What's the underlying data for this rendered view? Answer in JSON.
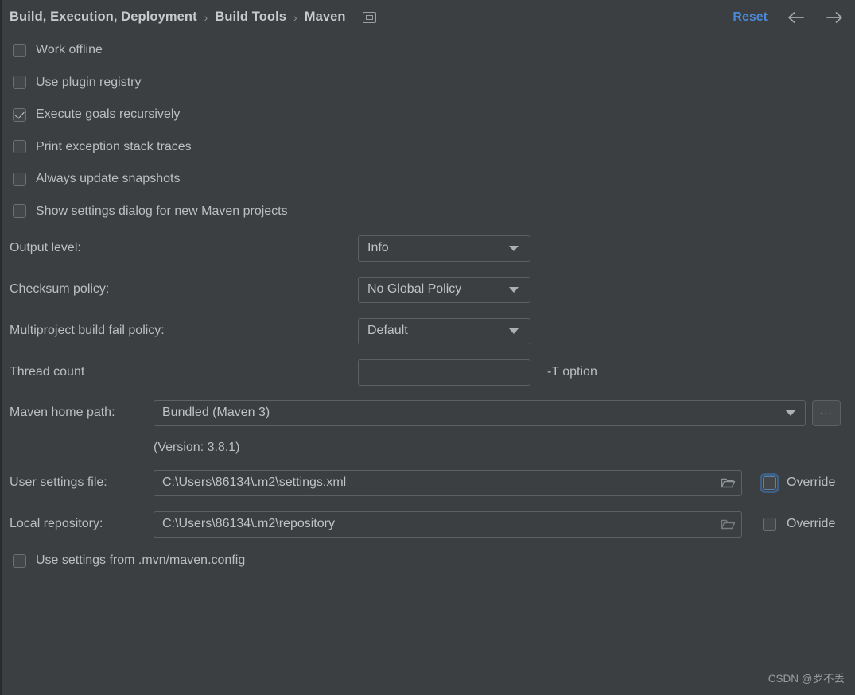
{
  "header": {
    "breadcrumb": [
      "Build, Execution, Deployment",
      "Build Tools",
      "Maven"
    ],
    "separator": "›",
    "window_icon": "window-icon",
    "reset_label": "Reset",
    "back_icon": "arrow-left-icon",
    "forward_icon": "arrow-right-icon"
  },
  "checkboxes": [
    {
      "label": "Work offline",
      "checked": false,
      "focused": false
    },
    {
      "label": "Use plugin registry",
      "checked": false,
      "focused": false
    },
    {
      "label": "Execute goals recursively",
      "checked": true,
      "focused": false
    },
    {
      "label": "Print exception stack traces",
      "checked": false,
      "focused": false
    },
    {
      "label": "Always update snapshots",
      "checked": false,
      "focused": false
    },
    {
      "label": "Show settings dialog for new Maven projects",
      "checked": false,
      "focused": false
    }
  ],
  "selects": [
    {
      "label": "Output level:",
      "value": "Info"
    },
    {
      "label": "Checksum policy:",
      "value": "No Global Policy"
    },
    {
      "label": "Multiproject build fail policy:",
      "value": "Default"
    }
  ],
  "thread_count": {
    "label": "Thread count",
    "value": "",
    "placeholder": "",
    "note": "-T option"
  },
  "maven_home": {
    "label": "Maven home path:",
    "value": "Bundled (Maven 3)",
    "browse_label": "...",
    "version_note": "(Version: 3.8.1)",
    "dropdown_icon": "chevron-down-icon"
  },
  "paths": [
    {
      "label": "User settings file:",
      "value": "C:\\Users\\86134\\.m2\\settings.xml",
      "folder_icon": "folder-icon",
      "override_label": "Override",
      "override_checked": false,
      "override_focused": true
    },
    {
      "label": "Local repository:",
      "value": "C:\\Users\\86134\\.m2\\repository",
      "folder_icon": "folder-icon",
      "override_label": "Override",
      "override_checked": false,
      "override_focused": false
    }
  ],
  "mvn_config": {
    "label": "Use settings from .mvn/maven.config",
    "checked": false
  },
  "watermark": "CSDN @罗不丢",
  "colors": {
    "background": "#3c3f41",
    "text": "#bcbfc1",
    "accent_link": "#4a88d8",
    "focus_ring": "#3d6185",
    "field_border": "#5c6164"
  }
}
